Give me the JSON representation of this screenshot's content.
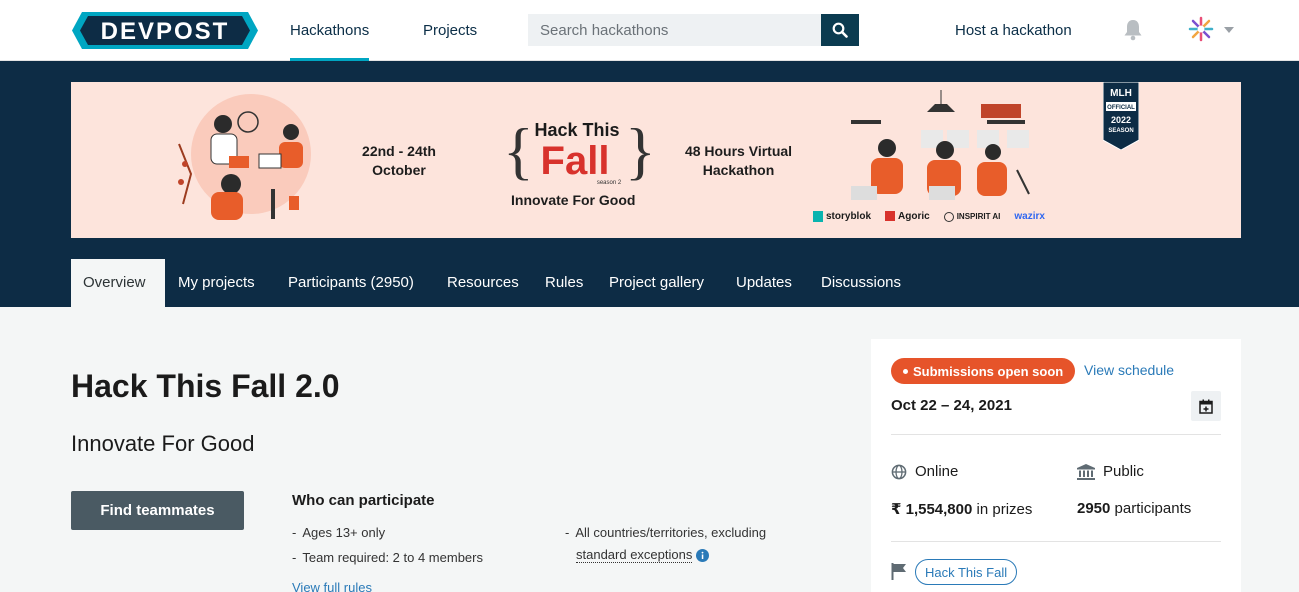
{
  "nav": {
    "logo_text": "DEVPOST",
    "hackathons": "Hackathons",
    "projects": "Projects",
    "search_placeholder": "Search hackathons",
    "host": "Host a hackathon"
  },
  "banner": {
    "dates": "22nd - 24th\nOctober",
    "logo_title": "Hack This",
    "logo_big": "Fall",
    "season": "season 2",
    "tagline": "Innovate For Good",
    "format": "48 Hours Virtual\nHackathon",
    "mlh_lines": [
      "MLH",
      "OFFICIAL",
      "2022",
      "SEASON"
    ],
    "sponsors": [
      "storyblok",
      "Agoric",
      "INSPIRIT AI",
      "wazirx"
    ]
  },
  "tabs": [
    "Overview",
    "My projects",
    "Participants (2950)",
    "Resources",
    "Rules",
    "Project gallery",
    "Updates",
    "Discussions"
  ],
  "main": {
    "title": "Hack This Fall 2.0",
    "tagline": "Innovate For Good",
    "find_button": "Find teammates",
    "who_heading": "Who can participate",
    "rule_age": "Ages 13+ only",
    "rule_team": "Team required: 2 to 4 members",
    "rule_countries": "All countries/territories, excluding",
    "rule_exceptions": "standard exceptions",
    "view_rules": "View full rules"
  },
  "card": {
    "status": "Submissions open soon",
    "schedule_link": "View schedule",
    "dates": "Oct 22 – 24, 2021",
    "location": "Online",
    "visibility": "Public",
    "prize_amount": "₹ 1,554,800",
    "prize_suffix": "in prizes",
    "participants_count": "2950",
    "participants_suffix": "participants",
    "theme": "Hack This Fall"
  },
  "colors": {
    "brand_dark": "#0d2c45",
    "accent_cyan": "#00a6c2",
    "status_orange": "#e6542a",
    "link_blue": "#2a7ab8"
  }
}
